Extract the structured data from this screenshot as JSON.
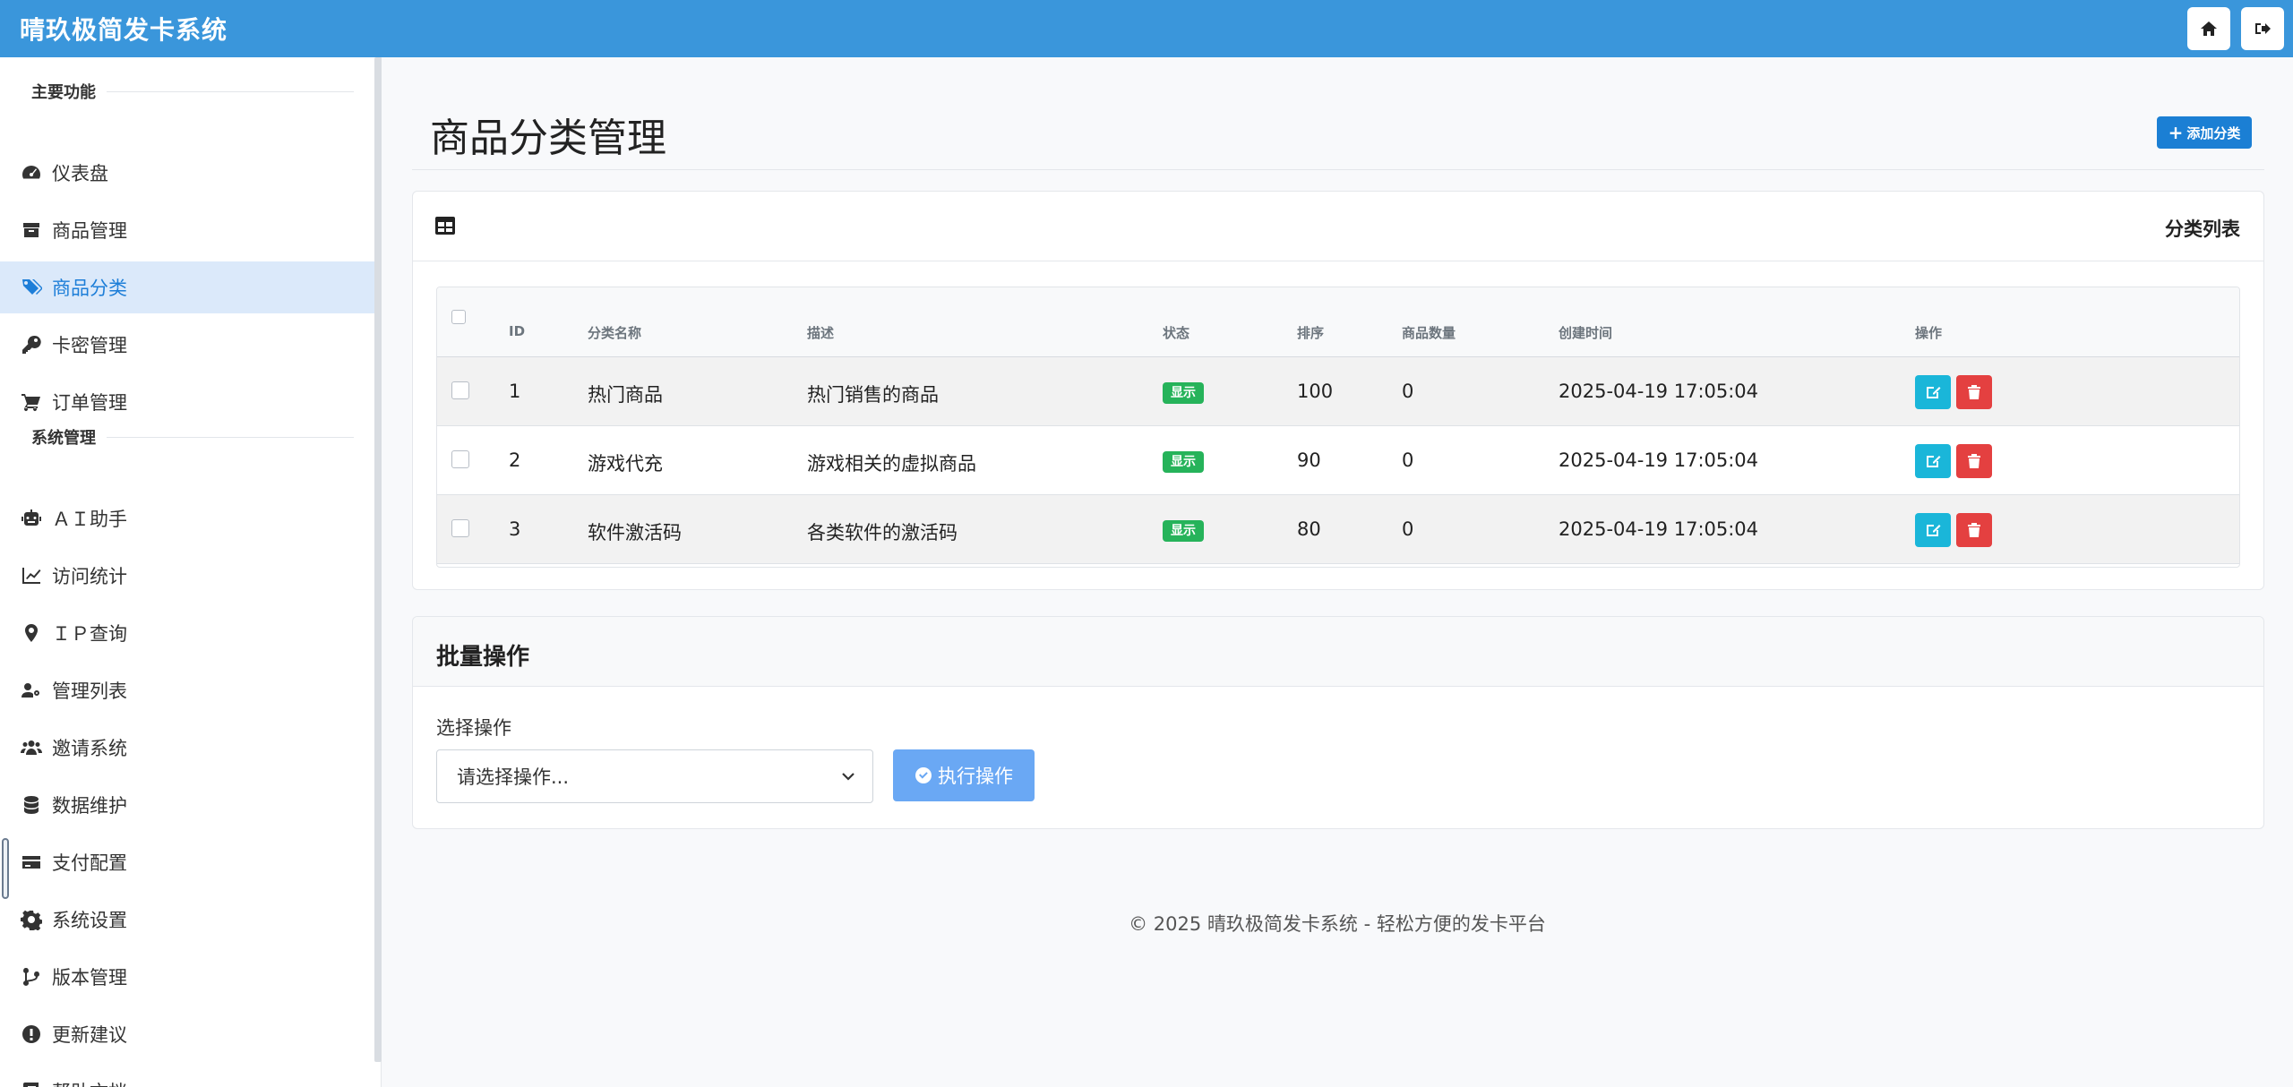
{
  "app": {
    "title": "晴玖极简发卡系统"
  },
  "sidebar": {
    "sections": [
      {
        "title": "主要功能"
      },
      {
        "title": "系统管理"
      }
    ],
    "items": [
      {
        "label": "仪表盘",
        "icon": "tachometer-icon"
      },
      {
        "label": "商品管理",
        "icon": "box-icon"
      },
      {
        "label": "商品分类",
        "icon": "tags-icon",
        "active": true
      },
      {
        "label": "卡密管理",
        "icon": "key-icon"
      },
      {
        "label": "订单管理",
        "icon": "cart-icon"
      },
      {
        "label": "ＡＩ助手",
        "icon": "robot-icon"
      },
      {
        "label": "访问统计",
        "icon": "chart-line-icon"
      },
      {
        "label": "ＩＰ查询",
        "icon": "map-marker-icon"
      },
      {
        "label": "管理列表",
        "icon": "users-cog-icon"
      },
      {
        "label": "邀请系统",
        "icon": "users-icon"
      },
      {
        "label": "数据维护",
        "icon": "database-icon"
      },
      {
        "label": "支付配置",
        "icon": "credit-card-icon"
      },
      {
        "label": "系统设置",
        "icon": "gear-icon"
      },
      {
        "label": "版本管理",
        "icon": "code-branch-icon"
      },
      {
        "label": "更新建议",
        "icon": "exclamation-circle-icon"
      },
      {
        "label": "帮助文档",
        "icon": "book-icon"
      }
    ]
  },
  "page": {
    "title": "商品分类管理",
    "add_button": "添加分类"
  },
  "list_card": {
    "title": "分类列表",
    "columns": [
      "ID",
      "分类名称",
      "描述",
      "状态",
      "排序",
      "商品数量",
      "创建时间",
      "操作"
    ],
    "rows": [
      {
        "id": "1",
        "name": "热门商品",
        "desc": "热门销售的商品",
        "status": "显示",
        "sort": "100",
        "count": "0",
        "created": "2025-04-19 17:05:04"
      },
      {
        "id": "2",
        "name": "游戏代充",
        "desc": "游戏相关的虚拟商品",
        "status": "显示",
        "sort": "90",
        "count": "0",
        "created": "2025-04-19 17:05:04"
      },
      {
        "id": "3",
        "name": "软件激活码",
        "desc": "各类软件的激活码",
        "status": "显示",
        "sort": "80",
        "count": "0",
        "created": "2025-04-19 17:05:04"
      }
    ]
  },
  "batch": {
    "title": "批量操作",
    "label": "选择操作",
    "select_value": "请选择操作...",
    "execute_button": "执行操作"
  },
  "footer": {
    "text": "© 2025 晴玖极简发卡系统 - 轻松方便的发卡平台"
  },
  "colors": {
    "navbar": "#3a96db",
    "primary": "#1b7fd4",
    "success": "#26b35a",
    "info": "#1ab6d9",
    "danger": "#e44040"
  }
}
